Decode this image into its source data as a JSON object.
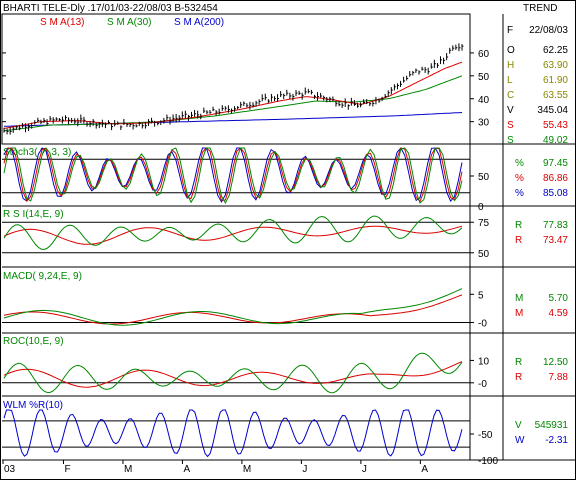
{
  "header": {
    "title": "BHARTI TELE-Dly .17/01/03-22/08/03  B-532454",
    "right_label": "TREND"
  },
  "colors": {
    "price": "#000000",
    "sma13": "#dd0000",
    "sma30": "#008800",
    "sma200": "#0000cc",
    "osc1": "#008800",
    "osc2": "#dd0000",
    "osc3": "#0000cc",
    "wlm": "#0000cc",
    "value_label": "#000000",
    "pct_label": "#008800"
  },
  "chart_data": [
    {
      "type": "line",
      "panel": "price",
      "legend": [
        {
          "name": "S M A(13)",
          "color": "#dd0000"
        },
        {
          "name": "S M A(30)",
          "color": "#008800"
        },
        {
          "name": "S M A(200)",
          "color": "#0000cc"
        }
      ],
      "ylim": [
        22,
        70
      ],
      "yticks": [
        30,
        40,
        50,
        60
      ],
      "info": [
        {
          "k": "F",
          "v": "22/08/03",
          "color": "#000000"
        },
        {
          "k": "O",
          "v": "62.25",
          "color": "#000000"
        },
        {
          "k": "H",
          "v": "63.90",
          "color": "#888800"
        },
        {
          "k": "L",
          "v": "61.90",
          "color": "#888800"
        },
        {
          "k": "C",
          "v": "63.55",
          "color": "#888800"
        },
        {
          "k": "V",
          "v": "345.04",
          "color": "#000000"
        },
        {
          "k": "S",
          "v": "55.43",
          "color": "#dd0000"
        },
        {
          "k": "S",
          "v": "49.02",
          "color": "#008800"
        }
      ],
      "close_points": [
        [
          0,
          26
        ],
        [
          0.06,
          29
        ],
        [
          0.12,
          31
        ],
        [
          0.18,
          30
        ],
        [
          0.24,
          28.5
        ],
        [
          0.3,
          29
        ],
        [
          0.36,
          31
        ],
        [
          0.42,
          33
        ],
        [
          0.48,
          35
        ],
        [
          0.54,
          38
        ],
        [
          0.6,
          41
        ],
        [
          0.66,
          42.5
        ],
        [
          0.7,
          40.5
        ],
        [
          0.74,
          38
        ],
        [
          0.78,
          37
        ],
        [
          0.82,
          40
        ],
        [
          0.86,
          46
        ],
        [
          0.9,
          52
        ],
        [
          0.93,
          53
        ],
        [
          0.96,
          57
        ],
        [
          0.98,
          63
        ],
        [
          1.0,
          63.5
        ]
      ],
      "sma13_points": [
        [
          0,
          27
        ],
        [
          0.08,
          30
        ],
        [
          0.16,
          30.5
        ],
        [
          0.24,
          29
        ],
        [
          0.32,
          29.5
        ],
        [
          0.42,
          32
        ],
        [
          0.52,
          35.5
        ],
        [
          0.6,
          39
        ],
        [
          0.66,
          41
        ],
        [
          0.72,
          39.5
        ],
        [
          0.78,
          37.5
        ],
        [
          0.84,
          41
        ],
        [
          0.9,
          47
        ],
        [
          0.96,
          53
        ],
        [
          1.0,
          56
        ]
      ],
      "sma30_points": [
        [
          0,
          26
        ],
        [
          0.1,
          28.5
        ],
        [
          0.22,
          29
        ],
        [
          0.34,
          30
        ],
        [
          0.46,
          32.5
        ],
        [
          0.58,
          36
        ],
        [
          0.68,
          39
        ],
        [
          0.76,
          38.5
        ],
        [
          0.84,
          40
        ],
        [
          0.92,
          44
        ],
        [
          1.0,
          50
        ]
      ],
      "sma200_points": [
        [
          0,
          28
        ],
        [
          0.3,
          29.5
        ],
        [
          0.6,
          31
        ],
        [
          0.85,
          32.5
        ],
        [
          1.0,
          34
        ]
      ]
    },
    {
      "type": "line",
      "panel": "stochastic",
      "title": "Stoch3( 7, 3, 3)",
      "ylim": [
        0,
        100
      ],
      "ref_lines": [
        20,
        80
      ],
      "yticks": [
        50
      ],
      "bottom_tick": "0",
      "values": [
        {
          "label": "%",
          "value": "97.45",
          "color": "#008800"
        },
        {
          "label": "%",
          "value": "86.86",
          "color": "#dd0000"
        },
        {
          "label": "%",
          "value": "85.08",
          "color": "#0000cc"
        }
      ]
    },
    {
      "type": "line",
      "panel": "rsi",
      "title": "R S I(14,E, 9)",
      "ylim": [
        40,
        85
      ],
      "ref_lines": [
        75,
        50
      ],
      "yticks": [
        75,
        50
      ],
      "values": [
        {
          "label": "R",
          "value": "77.83",
          "color": "#008800"
        },
        {
          "label": "R",
          "value": "73.47",
          "color": "#dd0000"
        }
      ]
    },
    {
      "type": "line",
      "panel": "macd",
      "title": "MACD( 9,24,E, 9)",
      "ylim": [
        -1.5,
        7
      ],
      "ref_lines": [
        0
      ],
      "yticks": [
        5,
        0
      ],
      "tick_labels": [
        "5",
        "-0"
      ],
      "values": [
        {
          "label": "M",
          "value": "5.70",
          "color": "#008800"
        },
        {
          "label": "M",
          "value": "4.59",
          "color": "#dd0000"
        }
      ]
    },
    {
      "type": "line",
      "panel": "roc",
      "title": "ROC(10,E, 9)",
      "ylim": [
        -5,
        16
      ],
      "ref_lines": [
        0
      ],
      "yticks": [
        10,
        0
      ],
      "tick_labels": [
        "10",
        "-0"
      ],
      "values": [
        {
          "label": "R",
          "value": "12.50",
          "color": "#008800"
        },
        {
          "label": "R",
          "value": "7.88",
          "color": "#dd0000"
        }
      ]
    },
    {
      "type": "line",
      "panel": "wlm",
      "title": "WLM %R(10)",
      "ylim": [
        -105,
        5
      ],
      "ref_lines": [
        -20,
        -80
      ],
      "yticks": [
        -50
      ],
      "bottom_tick": "-100",
      "values": [
        {
          "label": "V",
          "value": "545931",
          "color": "#008800"
        },
        {
          "label": "W",
          "value": "-2.31",
          "color": "#0000cc"
        }
      ]
    }
  ],
  "x_axis": {
    "ticks": [
      "03",
      "F",
      "M",
      "A",
      "M",
      "J",
      "J",
      "A"
    ]
  }
}
